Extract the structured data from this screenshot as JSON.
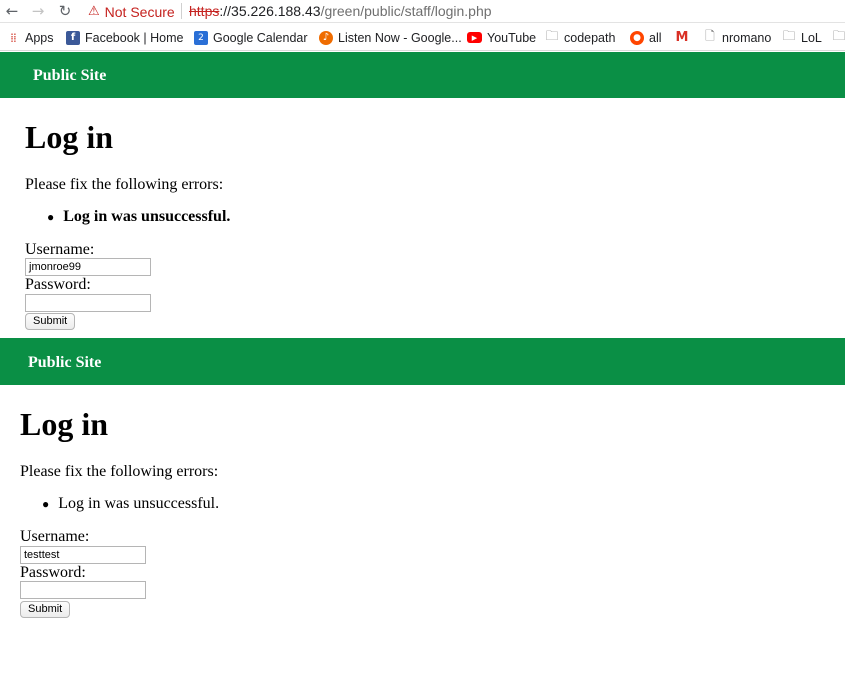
{
  "browser": {
    "nav": {
      "back_icon": "←",
      "forward_icon": "→",
      "reload_icon": "↻"
    },
    "security_warning": "Not Secure",
    "url": {
      "scheme": "https",
      "host": "://35.226.188.43",
      "path": "/green/public/staff/login.php"
    },
    "bookmarks": [
      {
        "label": "Apps",
        "icon": "apps-grid-icon"
      },
      {
        "label": "Facebook | Home",
        "icon": "facebook-icon"
      },
      {
        "label": "Google Calendar",
        "icon": "calendar-icon"
      },
      {
        "label": "Listen Now - Google...",
        "icon": "google-play-music-icon"
      },
      {
        "label": "YouTube",
        "icon": "youtube-icon"
      },
      {
        "label": "codepath",
        "icon": "folder-icon"
      },
      {
        "label": "all",
        "icon": "reddit-icon"
      },
      {
        "label": "",
        "icon": "gmail-icon"
      },
      {
        "label": "nromano",
        "icon": "page-icon"
      },
      {
        "label": "LoL",
        "icon": "folder-icon"
      }
    ]
  },
  "pages": [
    {
      "header": "Public Site",
      "title": "Log in",
      "error_intro": "Please fix the following errors:",
      "error_message": "Log in was unsuccessful.",
      "error_bold": true,
      "username_label": "Username:",
      "username_value": "jmonroe99",
      "password_label": "Password:",
      "password_value": "",
      "submit_label": "Submit"
    },
    {
      "header": "Public Site",
      "title": "Log in",
      "error_intro": "Please fix the following errors:",
      "error_message": "Log in was unsuccessful.",
      "error_bold": false,
      "username_label": "Username:",
      "username_value": "testtest",
      "password_label": "Password:",
      "password_value": "",
      "submit_label": "Submit"
    }
  ],
  "colors": {
    "header_green": "#0a8f45",
    "warning_red": "#c5221f"
  }
}
